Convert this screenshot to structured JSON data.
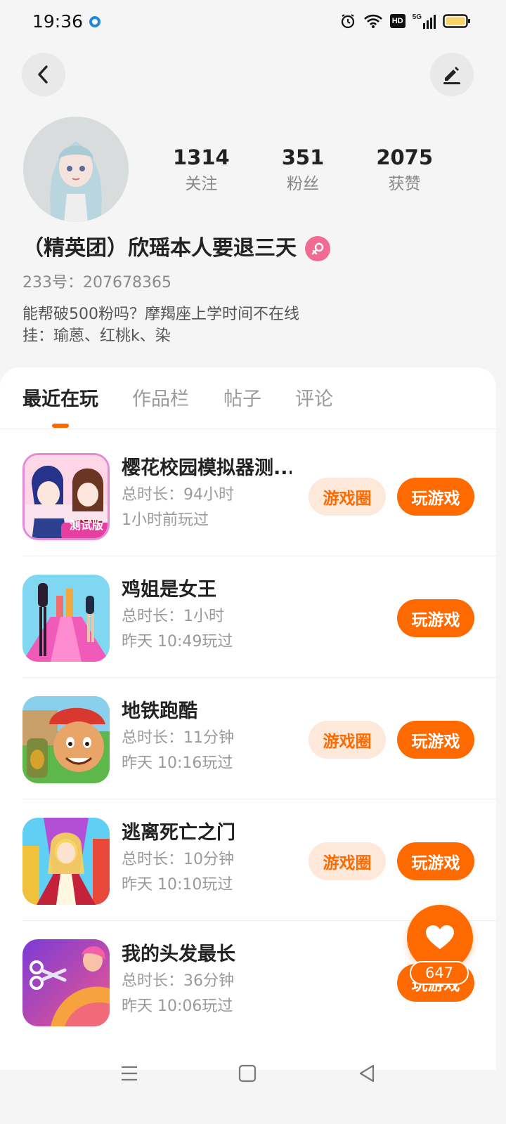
{
  "status_bar": {
    "time": "19:36",
    "icons": [
      "location-dot-icon",
      "alarm-icon",
      "wifi-icon",
      "hd-icon",
      "signal-5g-icon",
      "battery-icon"
    ],
    "hd_label": "HD",
    "network_label": "5G"
  },
  "header": {
    "back_icon": "chevron-left-icon",
    "edit_icon": "edit-pen-icon"
  },
  "profile": {
    "stats": [
      {
        "value": "1314",
        "label": "关注"
      },
      {
        "value": "351",
        "label": "粉丝"
      },
      {
        "value": "2075",
        "label": "获赞"
      }
    ],
    "nickname": "（精英团）欣瑶本人要退三天",
    "gender_icon": "female-icon",
    "uid": "233号：207678365",
    "bio_line1": "能帮破500粉吗？摩羯座上学时间不在线",
    "bio_line2": "挂：瑜蒽、红桃k、染"
  },
  "tabs": [
    {
      "label": "最近在玩",
      "active": true
    },
    {
      "label": "作品栏",
      "active": false
    },
    {
      "label": "帖子",
      "active": false
    },
    {
      "label": "评论",
      "active": false
    }
  ],
  "games": [
    {
      "name": "樱花校园模拟器测...",
      "duration": "总时长：94小时",
      "last_played": "1小时前玩过",
      "circle_label": "游戏圈",
      "play_label": "玩游戏",
      "icon_badge": "测试版"
    },
    {
      "name": "鸡姐是女王",
      "duration": "总时长：1小时",
      "last_played": "昨天 10:49玩过",
      "circle_label": "",
      "play_label": "玩游戏"
    },
    {
      "name": "地铁跑酷",
      "duration": "总时长：11分钟",
      "last_played": "昨天 10:16玩过",
      "circle_label": "游戏圈",
      "play_label": "玩游戏"
    },
    {
      "name": "逃离死亡之门",
      "duration": "总时长：10分钟",
      "last_played": "昨天 10:10玩过",
      "circle_label": "游戏圈",
      "play_label": "玩游戏"
    },
    {
      "name": "我的头发最长",
      "duration": "总时长：36分钟",
      "last_played": "昨天 10:06玩过",
      "circle_label": "",
      "play_label": "玩游戏"
    }
  ],
  "like": {
    "icon": "heart-icon",
    "count": "647"
  },
  "nav_bar": {
    "icons": [
      "menu-icon",
      "home-square-icon",
      "back-triangle-icon"
    ]
  },
  "colors": {
    "accent": "#ff6a00",
    "accent_light": "#fde8da",
    "gender_pink": "#f06c92",
    "background": "#f5f5f5"
  }
}
